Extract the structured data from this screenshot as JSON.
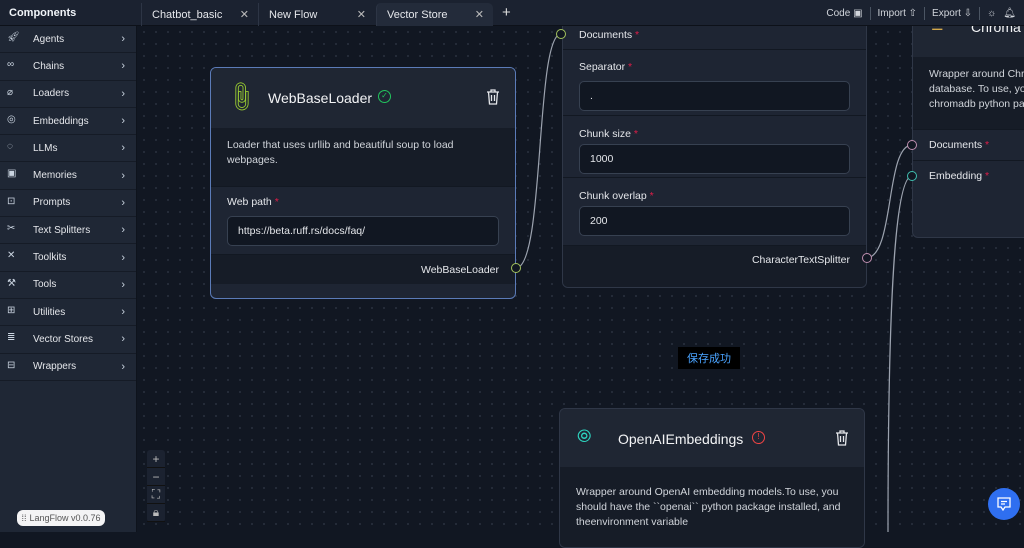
{
  "header": {
    "components_title": "Components",
    "tabs": [
      {
        "label": "Chatbot_basic"
      },
      {
        "label": "New Flow"
      },
      {
        "label": "Vector Store",
        "active": true
      }
    ],
    "tools": {
      "code": "Code",
      "import": "Import",
      "export": "Export"
    }
  },
  "sidebar": {
    "items": [
      {
        "label": "Agents",
        "icon": "rocket-icon"
      },
      {
        "label": "Chains",
        "icon": "link-icon"
      },
      {
        "label": "Loaders",
        "icon": "paperclip-icon"
      },
      {
        "label": "Embeddings",
        "icon": "fingerprint-icon"
      },
      {
        "label": "LLMs",
        "icon": "lightbulb-icon"
      },
      {
        "label": "Memories",
        "icon": "cpu-icon"
      },
      {
        "label": "Prompts",
        "icon": "terminal-icon"
      },
      {
        "label": "Text Splitters",
        "icon": "scissors-icon"
      },
      {
        "label": "Toolkits",
        "icon": "wrench-screwdriver-icon"
      },
      {
        "label": "Tools",
        "icon": "wrench-icon"
      },
      {
        "label": "Utilities",
        "icon": "grid-icon"
      },
      {
        "label": "Vector Stores",
        "icon": "database-icon"
      },
      {
        "label": "Wrappers",
        "icon": "gift-icon"
      }
    ]
  },
  "nodes": {
    "webloader": {
      "title": "WebBaseLoader",
      "description": "Loader that uses urllib and beautiful soup to load webpages.",
      "web_path_label": "Web path",
      "web_path_value": "https://beta.ruff.rs/docs/faq/",
      "output": "WebBaseLoader"
    },
    "splitter": {
      "documents_label": "Documents",
      "separator_label": "Separator",
      "separator_value": ".",
      "chunk_size_label": "Chunk size",
      "chunk_size_value": "1000",
      "chunk_overlap_label": "Chunk overlap",
      "chunk_overlap_value": "200",
      "output": "CharacterTextSplitter"
    },
    "chroma": {
      "title": "Chroma",
      "description": "Wrapper around Chroma vector database. To use, you should have the chromadb python package installed.",
      "documents_label": "Documents",
      "embedding_label": "Embedding"
    },
    "openai": {
      "title": "OpenAIEmbeddings",
      "description": "Wrapper around OpenAI embedding models.To use, you should have the ``openai`` python package installed, and theenvironment variable"
    }
  },
  "toast": "保存成功",
  "version": "LangFlow v0.0.76",
  "colors": {
    "accent": "#2f6ff0",
    "required": "#e11d48",
    "valid": "#22c55e",
    "error": "#ef4444"
  }
}
